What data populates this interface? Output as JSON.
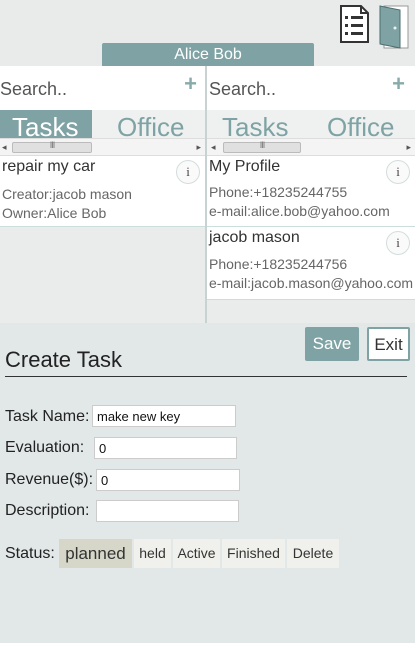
{
  "header": {
    "user_name": "Alice Bob",
    "icons": [
      "tasks-list-icon",
      "exit-door-icon"
    ]
  },
  "left_panel": {
    "search_placeholder": "Search..",
    "add_label": "+",
    "tabs": [
      "Tasks",
      "Office"
    ],
    "active_tab": "Tasks",
    "items": [
      {
        "title": "repair my car",
        "lines": [
          "Creator:jacob mason",
          "Owner:Alice Bob"
        ],
        "info_label": "i"
      }
    ]
  },
  "right_panel": {
    "search_placeholder": "Search..",
    "add_label": "+",
    "tabs": [
      "Tasks",
      "Office"
    ],
    "active_tab": "Office",
    "items": [
      {
        "title": "My Profile",
        "lines": [
          "Phone:+18235244755",
          "e-mail:alice.bob@yahoo.com"
        ],
        "info_label": "i"
      },
      {
        "title": "jacob mason",
        "lines": [
          "Phone:+18235244756",
          "e-mail:jacob.mason@yahoo.com"
        ],
        "info_label": "i"
      }
    ]
  },
  "scrollbar": {
    "left_arrow": "◂",
    "right_arrow": "▸",
    "grip": "III"
  },
  "create_task": {
    "title": "Create Task",
    "save_label": "Save",
    "exit_label": "Exit",
    "fields": [
      {
        "label": "Task Name:",
        "value": "make new key"
      },
      {
        "label": "Evaluation:",
        "value": "0"
      },
      {
        "label": "Revenue($):",
        "value": "0"
      },
      {
        "label": "Description:",
        "value": ""
      }
    ],
    "status_label": "Status:",
    "status_options": [
      "planned",
      "held",
      "Active",
      "Finished",
      "Delete"
    ],
    "selected_status": "planned"
  },
  "colors": {
    "accent": "#7fa3a4",
    "form_background": "#e2e8e8",
    "selected_status": "#d6d7c8"
  }
}
